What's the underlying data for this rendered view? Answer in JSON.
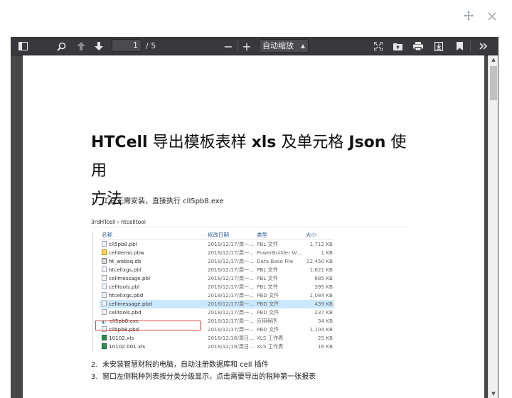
{
  "viewer": {
    "page_number": "1",
    "page_total": "/ 5",
    "zoom_label": "自动缩放",
    "zoom_minus": "−",
    "zoom_plus": "+"
  },
  "doc": {
    "title_line1_a": "HTCell",
    "title_line1_b": " 导出模板表样 ",
    "title_line1_c": "xls",
    "title_line1_d": " 及单元格 ",
    "title_line1_e": "Json",
    "title_line1_f": " 使用",
    "title_line2": "方法",
    "steps": [
      {
        "num": "1.",
        "text": "工具无需安装，直接执行 cll5pb8.exe"
      },
      {
        "num": "2.",
        "text": "未安装智慧财税的电脑，自动注册数据库和 cell 插件"
      },
      {
        "num": "3.",
        "text": "窗口左侧税种列表按分类分级显示，点击需要导出的税种第一张报表"
      }
    ]
  },
  "screenshot": {
    "breadcrumb": "3rdHTcell  ›  htcelltool",
    "headers": {
      "name": "名称",
      "date": "修改日期",
      "type": "类型",
      "size": "大小"
    },
    "files": [
      {
        "icon": "file",
        "name": "cll5pb8.pbl",
        "date": "2018/12/17/周一...",
        "type": "PBL 文件",
        "size": "1,712 KB"
      },
      {
        "icon": "pbw",
        "name": "celldemo.pbw",
        "date": "2018/12/17/周一...",
        "type": "PowerBuilder W...",
        "size": "1 KB"
      },
      {
        "icon": "db",
        "name": "ht_websq.db",
        "date": "2018/12/17/周一...",
        "type": "Data Base File",
        "size": "22,450 KB"
      },
      {
        "icon": "file",
        "name": "htcellxgs.pbl",
        "date": "2018/12/17/周一...",
        "type": "PBL 文件",
        "size": "1,621 KB"
      },
      {
        "icon": "file",
        "name": "cellmessage.pbl",
        "date": "2018/12/17/周一...",
        "type": "PBL 文件",
        "size": "685 KB"
      },
      {
        "icon": "file",
        "name": "celltools.pbl",
        "date": "2018/12/17/周一...",
        "type": "PBL 文件",
        "size": "395 KB"
      },
      {
        "icon": "file",
        "name": "htcellxgs.pbd",
        "date": "2018/12/17/周一...",
        "type": "PBD 文件",
        "size": "1,084 KB"
      },
      {
        "icon": "file",
        "name": "cellmessage.pbd",
        "date": "2018/12/17/周一...",
        "type": "PBD 文件",
        "size": "439 KB"
      },
      {
        "icon": "file",
        "name": "celltools.pbd",
        "date": "2018/12/17/周一...",
        "type": "PBD 文件",
        "size": "237 KB"
      },
      {
        "icon": "exe",
        "name": "cll5pb8.exe",
        "date": "2018/12/17/周一...",
        "type": "应用程序",
        "size": "34 KB"
      },
      {
        "icon": "file",
        "name": "cll5pb8.pbd",
        "date": "2018/12/17/周一...",
        "type": "PBD 文件",
        "size": "1,104 KB"
      },
      {
        "icon": "xls",
        "name": "10102.xls",
        "date": "2018/12/16/周日...",
        "type": "XLS 工作表",
        "size": "25 KB"
      },
      {
        "icon": "xls",
        "name": "10102 001.xls",
        "date": "2018/12/16/周日...",
        "type": "XLS 工作表",
        "size": "16 KB"
      }
    ]
  },
  "colors": {
    "toolbar": "#38383d",
    "viewer_bg": "#474747",
    "highlight": "#cce8ff",
    "red_box": "#e0463a"
  }
}
